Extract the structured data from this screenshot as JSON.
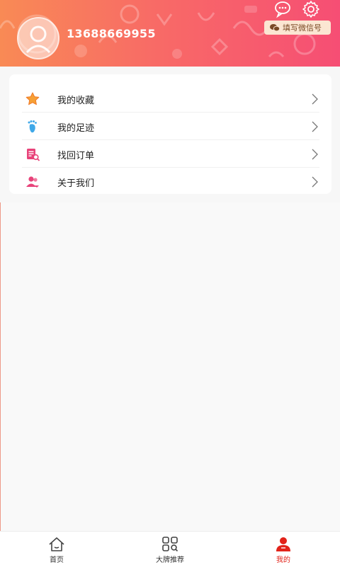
{
  "header": {
    "phone": "13688669955",
    "wechat_button_label": "填写微信号",
    "message_icon": "chat-bubble-icon",
    "settings_icon": "gear-icon"
  },
  "menu": {
    "items": [
      {
        "label": "我的收藏",
        "icon": "star-icon"
      },
      {
        "label": "我的足迹",
        "icon": "footprint-icon"
      },
      {
        "label": "找回订单",
        "icon": "order-search-icon"
      },
      {
        "label": "关于我们",
        "icon": "about-users-icon"
      }
    ]
  },
  "tabbar": {
    "tabs": [
      {
        "label": "首页",
        "icon": "home-icon",
        "active": false
      },
      {
        "label": "大牌推荐",
        "icon": "grid-icon",
        "active": false
      },
      {
        "label": "我的",
        "icon": "user-icon",
        "active": true
      }
    ]
  },
  "colors": {
    "header_gradient_start": "#f98a55",
    "header_gradient_end": "#f64e74",
    "accent_red": "#e2231a",
    "wechat_button_bg": "#fbe6d2"
  }
}
